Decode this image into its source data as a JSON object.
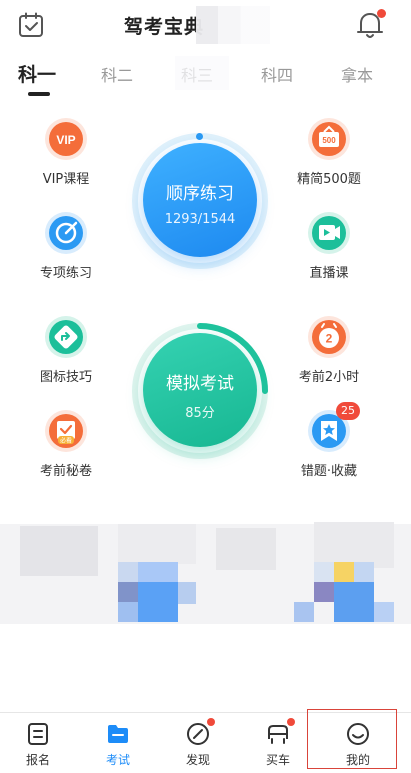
{
  "header": {
    "title": "驾考宝典",
    "has_notification_dot": true
  },
  "tabs": [
    "科一",
    "科二",
    "科三",
    "科四",
    "拿本"
  ],
  "active_tab": 0,
  "features": {
    "vip": {
      "label": "VIP课程",
      "icon_text": "VIP",
      "icon": "vip-icon"
    },
    "jingjian": {
      "label": "精简500题",
      "icon_text": "500",
      "icon": "500-icon"
    },
    "zhuanxiang": {
      "label": "专项练习",
      "icon": "target-icon"
    },
    "zhibo": {
      "label": "直播课",
      "icon": "video-play-icon"
    },
    "tubiao": {
      "label": "图标技巧",
      "icon": "sign-arrow-icon"
    },
    "kaoqian2": {
      "label": "考前2小时",
      "icon_text": "2",
      "icon": "clock-2-icon"
    },
    "mijuan": {
      "label": "考前秘卷",
      "icon_text": "必看",
      "icon": "secret-paper-icon"
    },
    "cuoti": {
      "label": "错题·收藏",
      "badge": "25",
      "icon": "bookmark-star-icon"
    }
  },
  "shunxu": {
    "title": "顺序练习",
    "progress": "1293/1544",
    "done": 1293,
    "total": 1544
  },
  "moni": {
    "title": "模拟考试",
    "score": "85分"
  },
  "bottom_nav": [
    {
      "label": "报名",
      "icon": "form-icon"
    },
    {
      "label": "考试",
      "icon": "folder-icon",
      "active": true
    },
    {
      "label": "发现",
      "icon": "compass-icon",
      "dot": true
    },
    {
      "label": "买车",
      "icon": "car-icon",
      "dot": true
    },
    {
      "label": "我的",
      "icon": "smile-face-icon"
    }
  ],
  "colors": {
    "blue": "#1d89f0",
    "green": "#17b792",
    "red_dot": "#f04a3a",
    "orange": "#f46d3a"
  }
}
